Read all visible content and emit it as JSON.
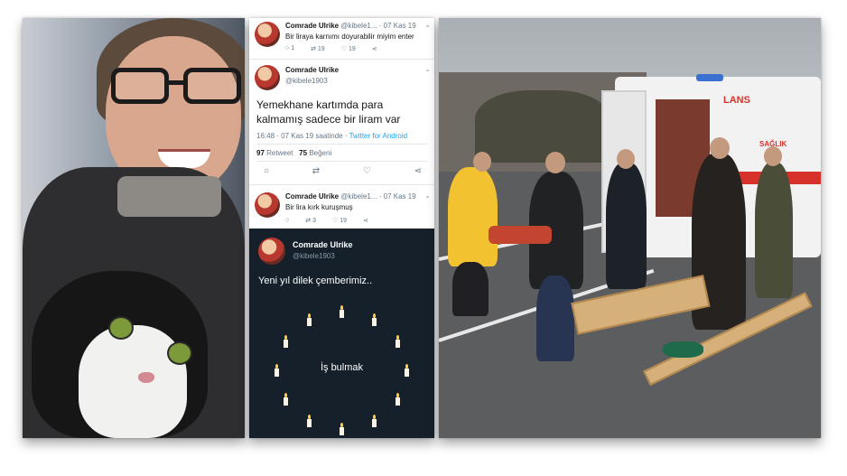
{
  "left_photo": {
    "alt": ""
  },
  "tweets": [
    {
      "name": "Comrade Ulrike",
      "handle": "@kibele1...",
      "date": "· 07 Kas 19",
      "text": "Bir liraya karnımı doyurabilir miyim enter",
      "actions": {
        "reply": "1",
        "retweet": "19",
        "like": "19"
      }
    },
    {
      "name": "Comrade Ulrike",
      "handle": "@kibele1903",
      "text_line1": "Yemekhane kartımda para",
      "text_line2": "kalmamış sadece bir liram var",
      "time": "16:48 · 07 Kas 19 saatinde ·",
      "app": "Twitter for Android",
      "retweets_count": "97",
      "retweets_label": "Retweet",
      "likes_count": "75",
      "likes_label": "Beğeni"
    },
    {
      "name": "Comrade Ulrike",
      "handle": "@kibele1...",
      "date": "· 07 Kas 19",
      "text": "Bir lira kırk kuruşmuş",
      "actions": {
        "reply": "",
        "retweet": "3",
        "like": "19"
      }
    }
  ],
  "dark_tweet": {
    "name": "Comrade Ulrike",
    "handle": "@kibele1903",
    "text": "Yeni yıl dilek çemberimiz..",
    "center_text": "İş bulmak"
  },
  "ambulance_label": "LANS",
  "ambulance_side": "SAĞLIK"
}
